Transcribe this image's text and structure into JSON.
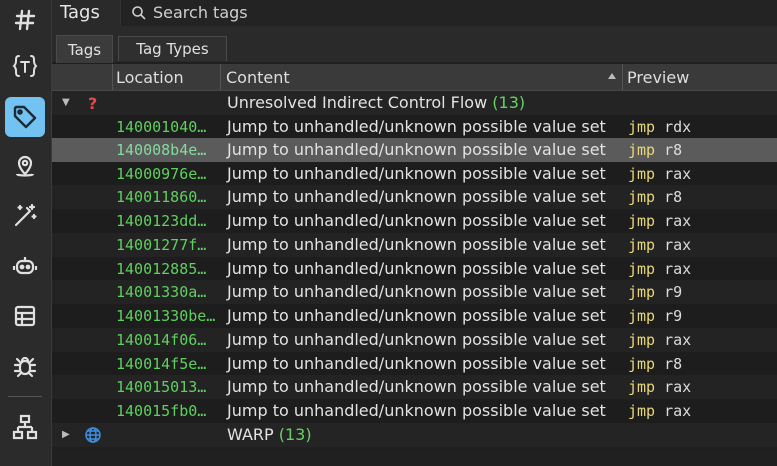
{
  "header": {
    "title": "Tags",
    "search_placeholder": "Search tags"
  },
  "tabs": [
    {
      "label": "Tags",
      "active": true
    },
    {
      "label": "Tag Types",
      "active": false
    }
  ],
  "columns": {
    "location": "Location",
    "content": "Content",
    "preview": "Preview"
  },
  "sidebar": {
    "icons": [
      "tag-hash-icon",
      "type-braces-icon",
      "tag-icon",
      "location-pin-icon",
      "magic-wand-icon",
      "robot-icon",
      "table-icon",
      "bug-icon",
      "hierarchy-icon"
    ],
    "active_index": 2,
    "accent": "#72c3f2"
  },
  "groups": [
    {
      "name": "Unresolved Indirect Control Flow",
      "count": "(13)",
      "expanded": true,
      "icon": "question-icon",
      "rows": [
        {
          "location": "140001040…",
          "content": "Jump to unhandled/unknown possible value set",
          "mnemonic": "jmp",
          "operand": "rdx"
        },
        {
          "location": "140008b4e…",
          "content": "Jump to unhandled/unknown possible value set",
          "mnemonic": "jmp",
          "operand": "r8"
        },
        {
          "location": "14000976e…",
          "content": "Jump to unhandled/unknown possible value set",
          "mnemonic": "jmp",
          "operand": "rax"
        },
        {
          "location": "140011860…",
          "content": "Jump to unhandled/unknown possible value set",
          "mnemonic": "jmp",
          "operand": "r8"
        },
        {
          "location": "1400123dd…",
          "content": "Jump to unhandled/unknown possible value set",
          "mnemonic": "jmp",
          "operand": "rax"
        },
        {
          "location": "14001277f…",
          "content": "Jump to unhandled/unknown possible value set",
          "mnemonic": "jmp",
          "operand": "rax"
        },
        {
          "location": "140012885…",
          "content": "Jump to unhandled/unknown possible value set",
          "mnemonic": "jmp",
          "operand": "rax"
        },
        {
          "location": "14001330a…",
          "content": "Jump to unhandled/unknown possible value set",
          "mnemonic": "jmp",
          "operand": "r9"
        },
        {
          "location": "14001330be…",
          "content": "Jump to unhandled/unknown possible value set",
          "mnemonic": "jmp",
          "operand": "r9"
        },
        {
          "location": "140014f06…",
          "content": "Jump to unhandled/unknown possible value set",
          "mnemonic": "jmp",
          "operand": "rax"
        },
        {
          "location": "140014f5e…",
          "content": "Jump to unhandled/unknown possible value set",
          "mnemonic": "jmp",
          "operand": "r8"
        },
        {
          "location": "140015013…",
          "content": "Jump to unhandled/unknown possible value set",
          "mnemonic": "jmp",
          "operand": "rax"
        },
        {
          "location": "140015fb0…",
          "content": "Jump to unhandled/unknown possible value set",
          "mnemonic": "jmp",
          "operand": "rax"
        }
      ]
    },
    {
      "name": "WARP",
      "count": "(13)",
      "expanded": false,
      "icon": "globe-icon",
      "rows": []
    }
  ],
  "selected_row": 1,
  "colors": {
    "address": "#5fd05f",
    "mnemonic": "#e8d77a",
    "count": "#66d266",
    "question": "#e04b4b",
    "globe": "#3f8fe0"
  }
}
